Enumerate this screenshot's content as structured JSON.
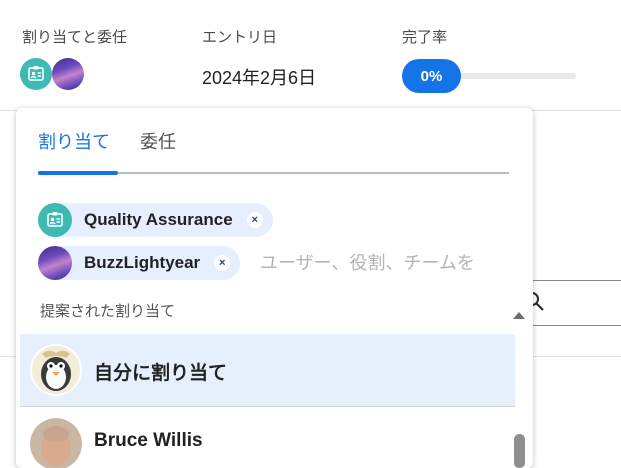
{
  "header": {
    "assign_label": "割り当てと委任",
    "entry_label": "エントリ日",
    "entry_value": "2024年2月6日",
    "completion_label": "完了率",
    "completion_value": "0%",
    "completion_fraction": 0
  },
  "popover": {
    "tabs": [
      {
        "label": "割り当て",
        "active": true
      },
      {
        "label": "委任",
        "active": false
      }
    ],
    "chips": [
      {
        "label": "Quality Assurance",
        "icon": "role-badge-icon",
        "remove_symbol": "×"
      },
      {
        "label": "BuzzLightyear",
        "icon": "avatar",
        "remove_symbol": "×"
      }
    ],
    "search_placeholder": "ユーザー、役割、チームを",
    "section_label": "提案された割り当て",
    "items": [
      {
        "label": "自分に割り当て",
        "selected": true
      },
      {
        "label": "Bruce Willis",
        "selected": false
      }
    ]
  },
  "colors": {
    "accent": "#1473e6",
    "chip_bg": "#e5efff",
    "role_badge": "#3fb9b4",
    "selected_row": "#e5f0fc"
  }
}
